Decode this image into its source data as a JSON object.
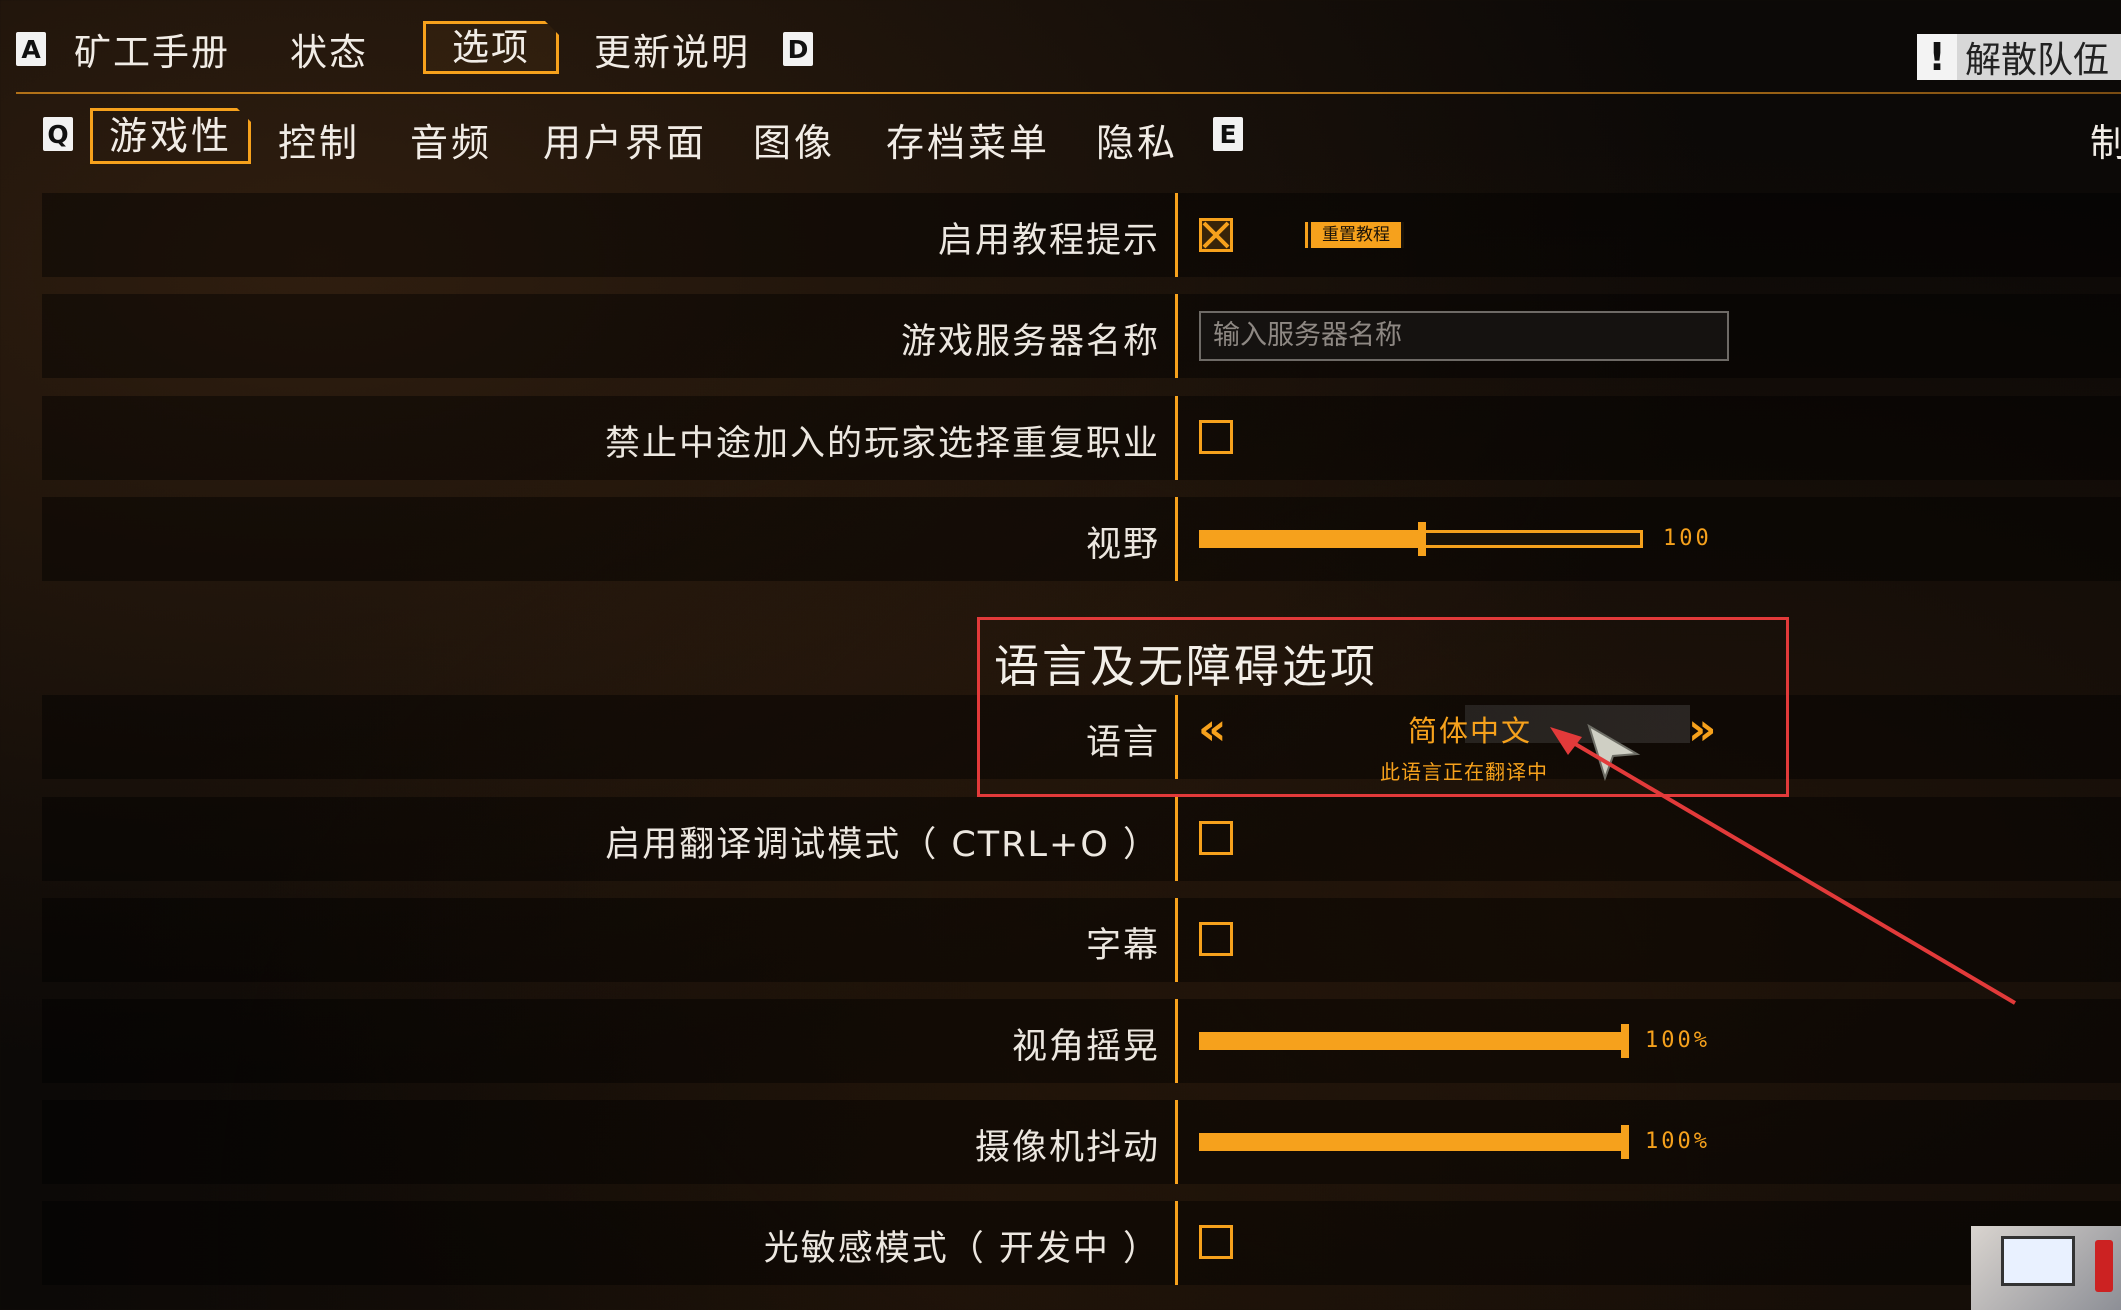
{
  "top_nav": {
    "key_left": "A",
    "items": [
      "矿工手册",
      "状态",
      "选项",
      "更新说明"
    ],
    "active_index": 2,
    "key_right": "D",
    "disband_label": "解散队伍",
    "disband_icon": "!"
  },
  "sub_nav": {
    "key_left": "Q",
    "items": [
      "游戏性",
      "控制",
      "音频",
      "用户界面",
      "图像",
      "存档菜单",
      "隐私"
    ],
    "active_index": 0,
    "key_right": "E",
    "overflow_label": "制"
  },
  "settings": {
    "tutorial": {
      "label": "启用教程提示",
      "checked": true,
      "reset_label": "重置教程"
    },
    "server_name": {
      "label": "游戏服务器名称",
      "placeholder": "输入服务器名称"
    },
    "no_dup_class": {
      "label": "禁止中途加入的玩家选择重复职业",
      "checked": false
    },
    "fov": {
      "label": "视野",
      "value": "100",
      "fraction": 0.5
    },
    "section_title": "语言及无障碍选项",
    "language": {
      "label": "语言",
      "value": "简体中文",
      "note": "此语言正在翻译中",
      "prev_icon": "«",
      "next_icon": "»"
    },
    "translation_debug": {
      "label": "启用翻译调试模式（ CTRL+O ）",
      "checked": false
    },
    "subtitles": {
      "label": "字幕",
      "checked": false
    },
    "view_bob": {
      "label": "视角摇晃",
      "value": "100%",
      "fraction": 1.0
    },
    "camera_shake": {
      "label": "摄像机抖动",
      "value": "100%",
      "fraction": 1.0
    },
    "photosensitive": {
      "label": "光敏感模式（ 开发中 ）",
      "checked": false
    }
  },
  "colors": {
    "accent": "#f6a11c",
    "annotation": "#e23a3a"
  }
}
